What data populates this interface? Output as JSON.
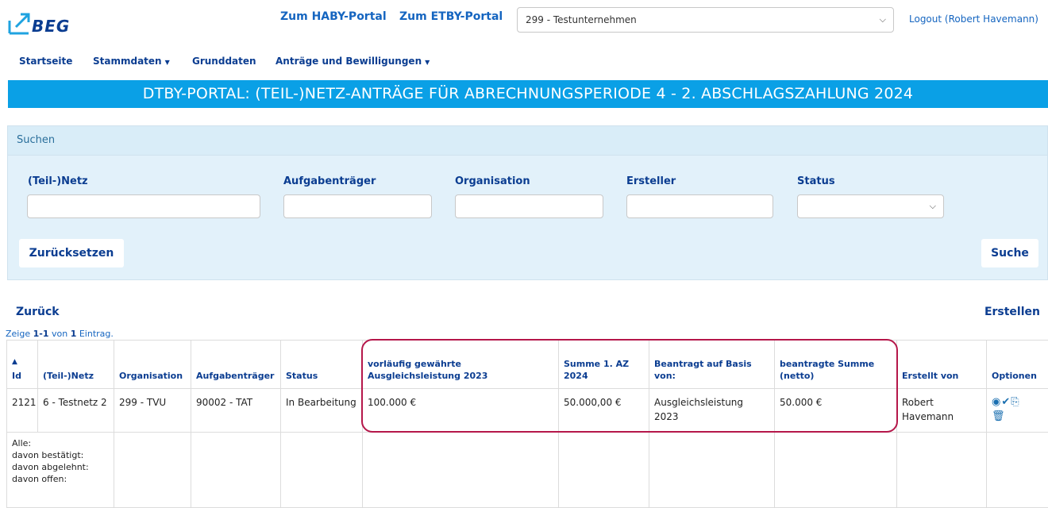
{
  "header": {
    "logo_text": "BEG",
    "link_haby": "Zum HABY-Portal",
    "link_etby": "Zum ETBY-Portal",
    "org_selected": "299 - Testunternehmen",
    "logout": "Logout (Robert Havemann)"
  },
  "nav": {
    "items": [
      "Startseite",
      "Stammdaten",
      "Grunddaten",
      "Anträge und Bewilligungen"
    ]
  },
  "title": "DTBY-PORTAL: (TEIL-)NETZ-ANTRÄGE FÜR ABRECHNUNGSPERIODE 4 - 2. ABSCHLAGSZAHLUNG 2024",
  "search": {
    "heading": "Suchen",
    "fields": [
      "(Teil-)Netz",
      "Aufgabenträger",
      "Organisation",
      "Ersteller",
      "Status"
    ],
    "reset_button": "Zurücksetzen",
    "search_button": "Suche"
  },
  "back": "Zurück",
  "create": "Erstellen",
  "summary": {
    "prefix": "Zeige ",
    "range": "1-1",
    "mid": " von ",
    "total": "1",
    "suffix": " Eintrag."
  },
  "table": {
    "columns": [
      "Id",
      "(Teil-)Netz",
      "Organisation",
      "Aufgabenträger",
      "Status",
      "vorläufig gewährte Ausgleichsleistung 2023",
      "Summe 1. AZ 2024",
      "Beantragt auf Basis von:",
      "beantragte Summe (netto)",
      "Erstellt von",
      "Optionen"
    ],
    "rows": [
      [
        "2121",
        "6 - Testnetz 2",
        "299 - TVU",
        "90002 - TAT",
        "In Bearbeitung",
        "100.000 €",
        "50.000,00 €",
        "Ausgleichsleistung 2023",
        "50.000 €",
        "Robert Havemann"
      ]
    ],
    "summary_lines": [
      "Alle:",
      "davon bestätigt:",
      "davon abgelehnt:",
      "davon offen:"
    ]
  },
  "icons": [
    "view-icon",
    "approve-icon",
    "export-icon",
    "delete-icon"
  ],
  "colors": {
    "brand": "#0b3d91",
    "title_bar": "#0aa0e6",
    "highlight": "#b5174a",
    "panel": "#e2f1fa"
  }
}
